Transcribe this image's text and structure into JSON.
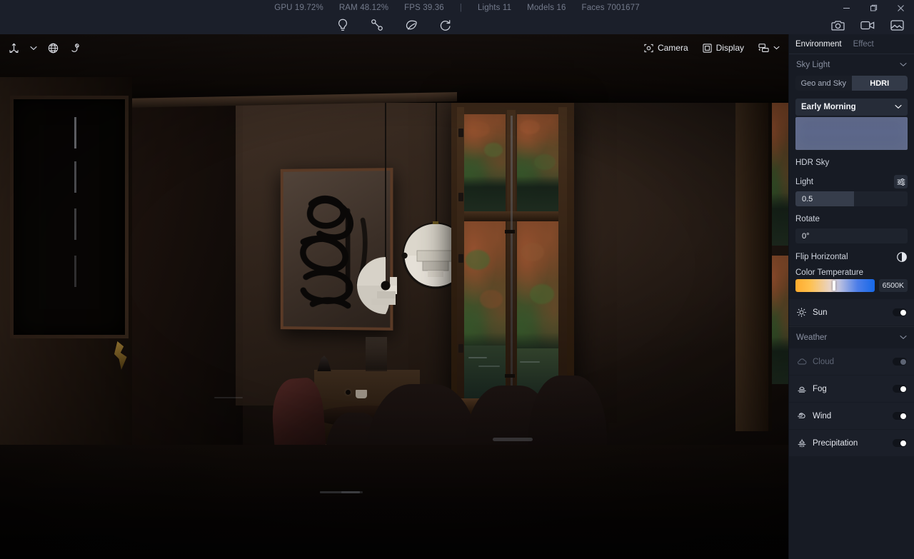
{
  "titlebar": {
    "stats": [
      {
        "label": "GPU 19.72%"
      },
      {
        "label": "RAM 48.12%"
      },
      {
        "label": "FPS 39.36"
      },
      {
        "label": "|"
      },
      {
        "label": "Lights 11"
      },
      {
        "label": "Models 16"
      },
      {
        "label": "Faces 7001677"
      }
    ],
    "window_controls": [
      {
        "name": "minimize-button",
        "glyph": "minimize"
      },
      {
        "name": "restore-button",
        "glyph": "restore"
      },
      {
        "name": "close-button",
        "glyph": "close"
      }
    ],
    "capture_buttons": [
      {
        "name": "screenshot-button",
        "icon": "camera-icon"
      },
      {
        "name": "record-video-button",
        "icon": "video-camera-icon"
      },
      {
        "name": "export-image-button",
        "icon": "image-export-icon"
      }
    ]
  },
  "tools": [
    {
      "name": "light-bulb-tool",
      "icon": "light-bulb-icon"
    },
    {
      "name": "measure-tool",
      "icon": "line-segment-icon"
    },
    {
      "name": "material-tool",
      "icon": "leaf-icon"
    },
    {
      "name": "undo-tool",
      "icon": "undo-icon"
    }
  ],
  "viewport_toolbar": {
    "left": [
      {
        "name": "transform-gizmo-button",
        "icon": "move-gizmo-icon"
      },
      {
        "name": "transform-gizmo-dropdown",
        "icon": "chevron-down-icon"
      },
      {
        "name": "world-space-button",
        "icon": "globe-icon"
      },
      {
        "name": "snap-button",
        "icon": "magnet-icon"
      }
    ],
    "camera_label": "Camera",
    "display_label": "Display",
    "layout_dropdown": {
      "name": "viewport-layout-dropdown",
      "icon": "layout-icon"
    }
  },
  "panel": {
    "tabs": [
      {
        "label": "Environment",
        "active": true
      },
      {
        "label": "Effect",
        "active": false
      }
    ],
    "sky_light": {
      "title": "Sky Light",
      "segments": [
        {
          "label": "Geo and Sky",
          "active": false
        },
        {
          "label": "HDRI",
          "active": true
        }
      ],
      "preset": "Early Morning",
      "preview_color": "#5b6587"
    },
    "hdr_sky": {
      "title": "HDR Sky",
      "light_label": "Light",
      "light_value": "0.5",
      "light_fill_percent": 52,
      "rotate_label": "Rotate",
      "rotate_value": "0°",
      "flip_label": "Flip Horizontal",
      "color_temp_label": "Color Temperature",
      "color_temp_value": "6500K",
      "color_temp_knob_percent": 47,
      "gradient_start": "#ffab2d",
      "gradient_end": "#1668e8"
    },
    "sun": {
      "label": "Sun",
      "icon": "sun-icon",
      "enabled": true,
      "dimmed": false
    },
    "weather": {
      "title": "Weather",
      "items": [
        {
          "label": "Cloud",
          "icon": "cloud-icon",
          "enabled": false,
          "dimmed": true
        },
        {
          "label": "Fog",
          "icon": "fog-icon",
          "enabled": true,
          "dimmed": false
        },
        {
          "label": "Wind",
          "icon": "wind-icon",
          "enabled": true,
          "dimmed": false
        },
        {
          "label": "Precipitation",
          "icon": "precipitation-icon",
          "enabled": true,
          "dimmed": false
        }
      ]
    }
  },
  "scene": {
    "description": "Dark interior room render with pendant lamps, abstract wall art, French windows to autumn forest and lake"
  }
}
